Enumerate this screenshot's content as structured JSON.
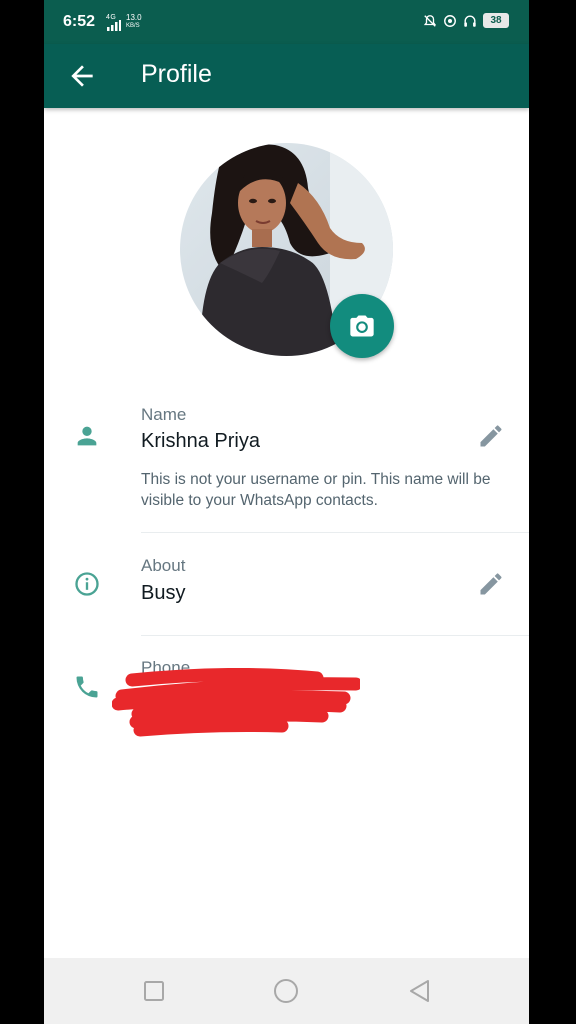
{
  "status_bar": {
    "time": "6:52",
    "network": "4G",
    "speed": "13.0",
    "speed_unit": "KB/S",
    "battery": "38",
    "icons": [
      "signal-icon",
      "alarm-off-icon",
      "whatsapp-status-icon",
      "headphones-icon",
      "battery-icon"
    ]
  },
  "app_bar": {
    "title": "Profile",
    "back_icon": "arrow-back-icon"
  },
  "profile": {
    "avatar_icon": "profile-photo",
    "camera_icon": "camera-icon"
  },
  "name_section": {
    "label": "Name",
    "value": "Krishna Priya",
    "hint": "This is not your username or pin. This name will be visible to your WhatsApp contacts.",
    "icon": "person-icon",
    "edit_icon": "pencil-icon"
  },
  "about_section": {
    "label": "About",
    "value": "Busy",
    "icon": "info-icon",
    "edit_icon": "pencil-icon"
  },
  "phone_section": {
    "label": "Phone",
    "icon": "phone-icon"
  },
  "nav_bar": {
    "icons": [
      "recents-icon",
      "home-icon",
      "back-icon"
    ]
  },
  "colors": {
    "status_bar": "#0b5d4f",
    "app_bar": "#075e54",
    "accent": "#128c7e",
    "icon_teal": "#4aa394",
    "background": "#ffffff",
    "redaction": "#e8282b"
  }
}
